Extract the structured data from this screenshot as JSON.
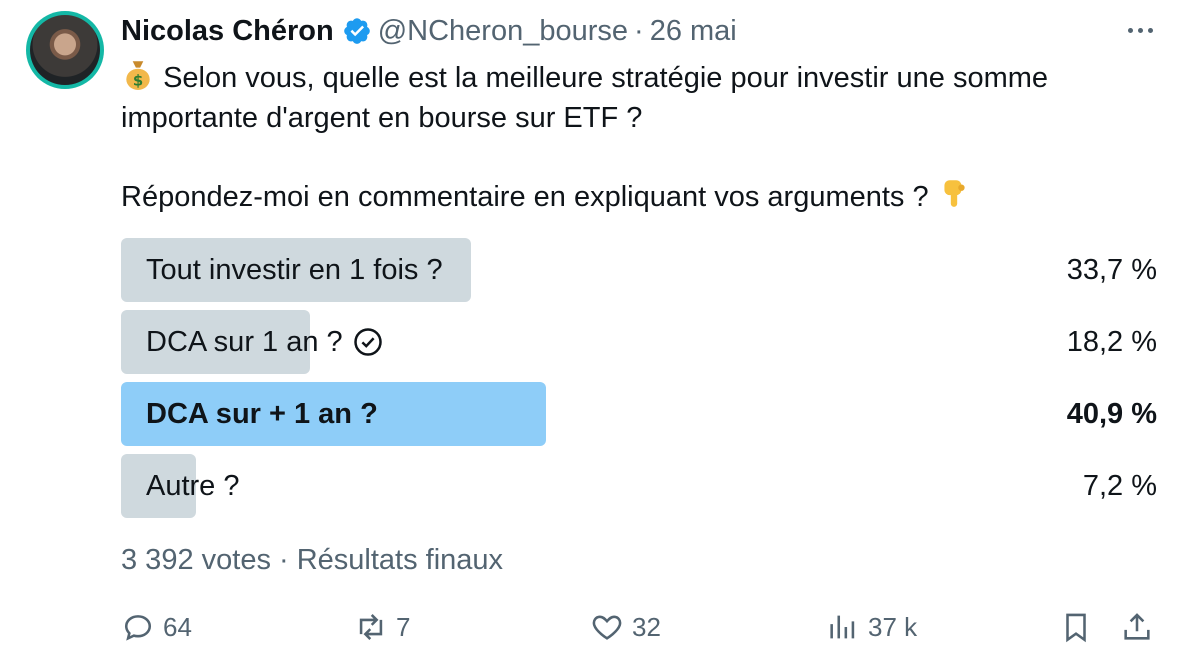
{
  "author": {
    "name": "Nicolas Chéron",
    "handle": "@NCheron_bourse",
    "separator": "·",
    "date": "26 mai"
  },
  "tweet": {
    "line1": "Selon vous, quelle est la meilleure stratégie pour investir une somme importante d'argent en bourse sur ETF ?",
    "line2": "Répondez-moi en commentaire en expliquant vos arguments ?"
  },
  "poll": {
    "options": [
      {
        "label": "Tout investir en 1 fois ?",
        "percent_text": "33,7 %",
        "percent": 33.7,
        "winner": false,
        "voted": false
      },
      {
        "label": "DCA sur 1 an ?",
        "percent_text": "18,2 %",
        "percent": 18.2,
        "winner": false,
        "voted": true
      },
      {
        "label": "DCA sur + 1 an ?",
        "percent_text": "40,9 %",
        "percent": 40.9,
        "winner": true,
        "voted": false
      },
      {
        "label": "Autre ?",
        "percent_text": "7,2 %",
        "percent": 7.2,
        "winner": false,
        "voted": false
      }
    ],
    "summary": "3 392 votes · Résultats finaux"
  },
  "actions": {
    "replies": "64",
    "retweets": "7",
    "likes": "32",
    "views": "37 k"
  },
  "colors": {
    "bar": "#cfd9de",
    "winner_bar": "#8ecdf8",
    "verified": "#1d9bf0",
    "secondary_text": "#536471"
  }
}
